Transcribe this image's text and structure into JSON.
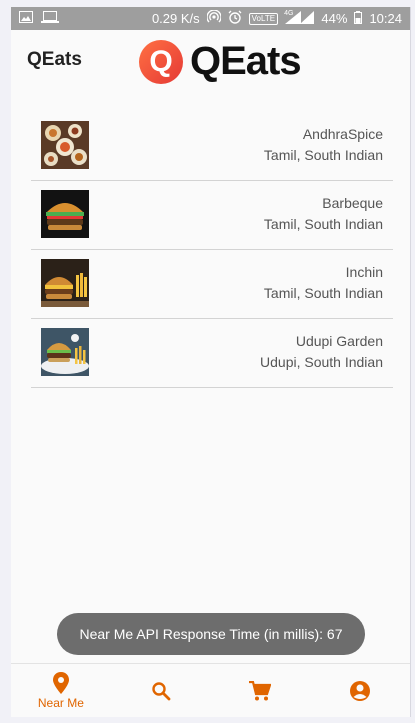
{
  "status_bar": {
    "network_speed": "0.29 K/s",
    "volte": "VoLTE",
    "network_type": "4G",
    "battery": "44%",
    "time": "10:24"
  },
  "app_bar": {
    "title": "QEats",
    "logo_letter": "Q",
    "logo_text": "QEats"
  },
  "restaurants": [
    {
      "name": "AndhraSpice",
      "cuisine": "Tamil, South Indian",
      "thumb": "spread-icon"
    },
    {
      "name": "Barbeque",
      "cuisine": "Tamil, South Indian",
      "thumb": "burger-icon"
    },
    {
      "name": "Inchin",
      "cuisine": "Tamil, South Indian",
      "thumb": "burger-fries-icon"
    },
    {
      "name": "Udupi Garden",
      "cuisine": "Udupi, South Indian",
      "thumb": "burger-plate-icon"
    }
  ],
  "toast": {
    "text": "Near Me API Response Time (in millis): 67"
  },
  "bottom_nav": {
    "near_me_label": "Near Me",
    "accent_color": "#e06500"
  }
}
